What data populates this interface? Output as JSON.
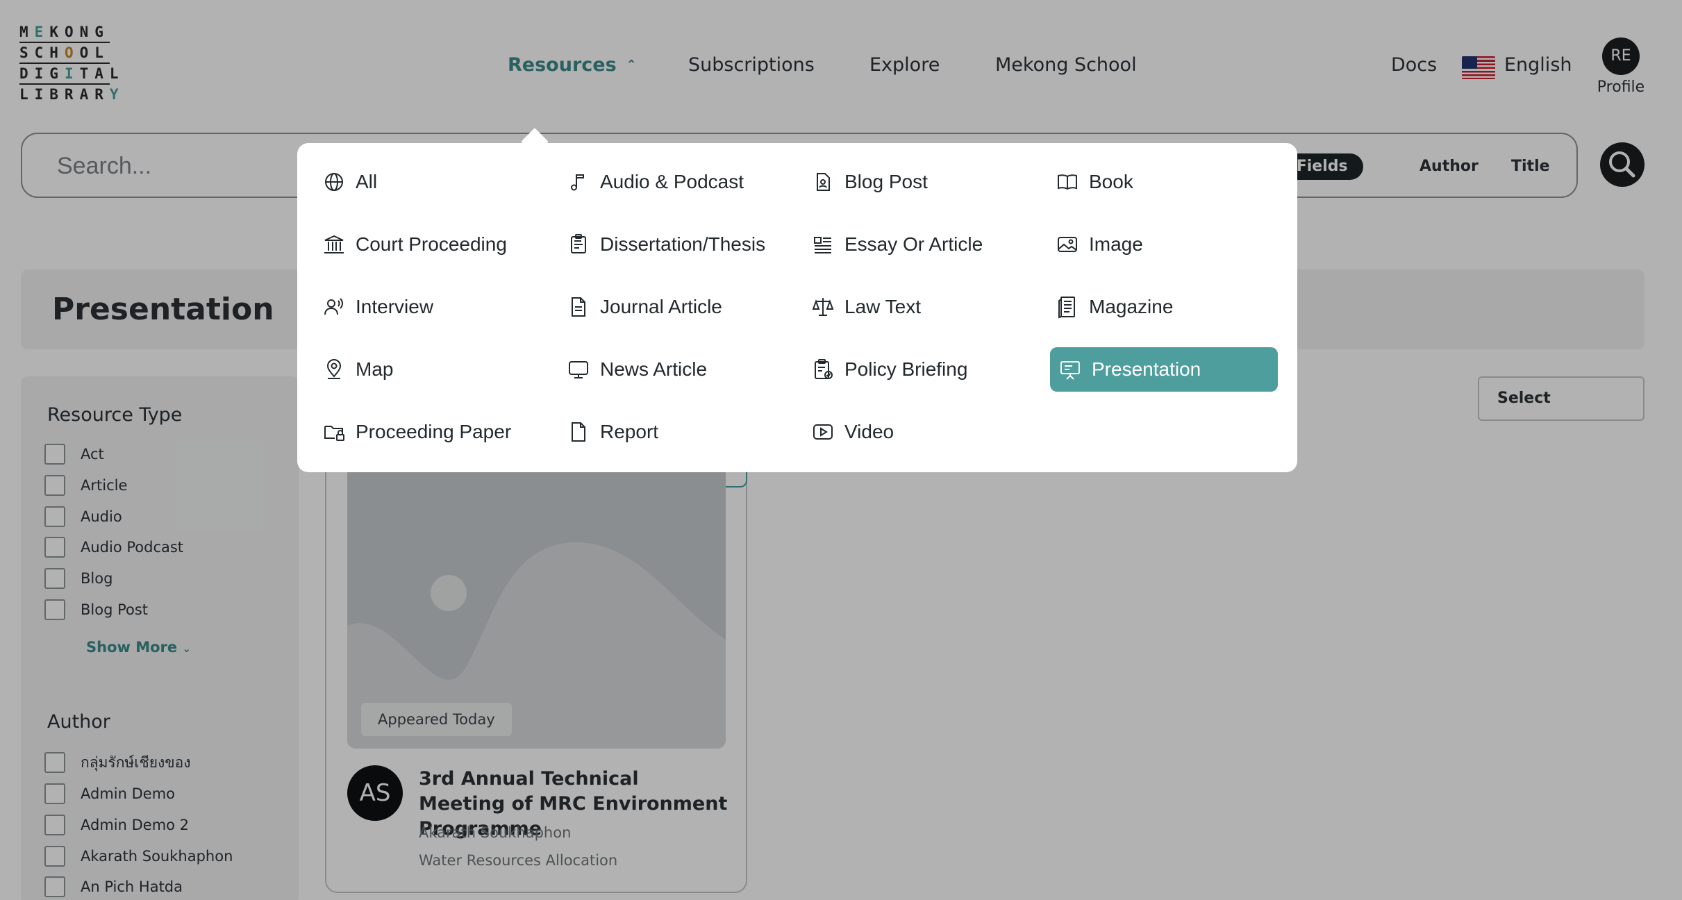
{
  "logo": {
    "lines": [
      "M",
      "E",
      "KONG",
      "SCH",
      "O",
      "OL",
      "DIG",
      "I",
      "TAL",
      "LIBRAR",
      "Y"
    ]
  },
  "nav": {
    "resources": "Resources",
    "subscriptions": "Subscriptions",
    "explore": "Explore",
    "mekong_school": "Mekong School",
    "docs": "Docs",
    "language": "English",
    "avatar_initials": "RE",
    "profile": "Profile"
  },
  "search": {
    "placeholder": "Search...",
    "fields": [
      "ll Fields",
      "Author",
      "Title"
    ]
  },
  "page_title": "Presentation",
  "sidebar": {
    "resource_type_heading": "Resource Type",
    "resource_types": [
      "Act",
      "Article",
      "Audio",
      "Audio Podcast",
      "Blog",
      "Blog Post"
    ],
    "show_more": "Show More",
    "author_heading": "Author",
    "authors": [
      "กลุ่มรักษ์เชียงของ",
      "Admin Demo",
      "Admin Demo 2",
      "Akarath Soukhaphon",
      "An Pich Hatda"
    ]
  },
  "sort": {
    "label": "Select"
  },
  "card": {
    "badge": "Appeared Today",
    "avatar_initials": "AS",
    "title": "3rd Annual Technical Meeting of MRC Environment Programme",
    "author": "Akarath Soukhaphon",
    "topic": "Water Resources Allocation"
  },
  "dropdown": {
    "items": [
      {
        "label": "All",
        "icon": "globe-icon"
      },
      {
        "label": "Audio & Podcast",
        "icon": "music-note-icon"
      },
      {
        "label": "Blog Post",
        "icon": "blog-post-icon"
      },
      {
        "label": "Book",
        "icon": "book-icon"
      },
      {
        "label": "Court Proceeding",
        "icon": "courthouse-icon"
      },
      {
        "label": "Dissertation/Thesis",
        "icon": "thesis-icon"
      },
      {
        "label": "Essay Or Article",
        "icon": "article-icon"
      },
      {
        "label": "Image",
        "icon": "image-icon"
      },
      {
        "label": "Interview",
        "icon": "interview-icon"
      },
      {
        "label": "Journal Article",
        "icon": "document-icon"
      },
      {
        "label": "Law Text",
        "icon": "scales-icon"
      },
      {
        "label": "Magazine",
        "icon": "magazine-icon"
      },
      {
        "label": "Map",
        "icon": "map-pin-icon"
      },
      {
        "label": "News Article",
        "icon": "monitor-icon"
      },
      {
        "label": "Policy Briefing",
        "icon": "policy-icon"
      },
      {
        "label": "Presentation",
        "icon": "presentation-icon"
      },
      {
        "label": "Proceeding Paper",
        "icon": "folder-lock-icon"
      },
      {
        "label": "Report",
        "icon": "file-icon"
      },
      {
        "label": "Video",
        "icon": "video-icon"
      }
    ],
    "selected": "Presentation"
  },
  "colors": {
    "accent": "#4e9e9d",
    "accent_text": "#3b8a8a",
    "dark": "#1a1d20"
  }
}
